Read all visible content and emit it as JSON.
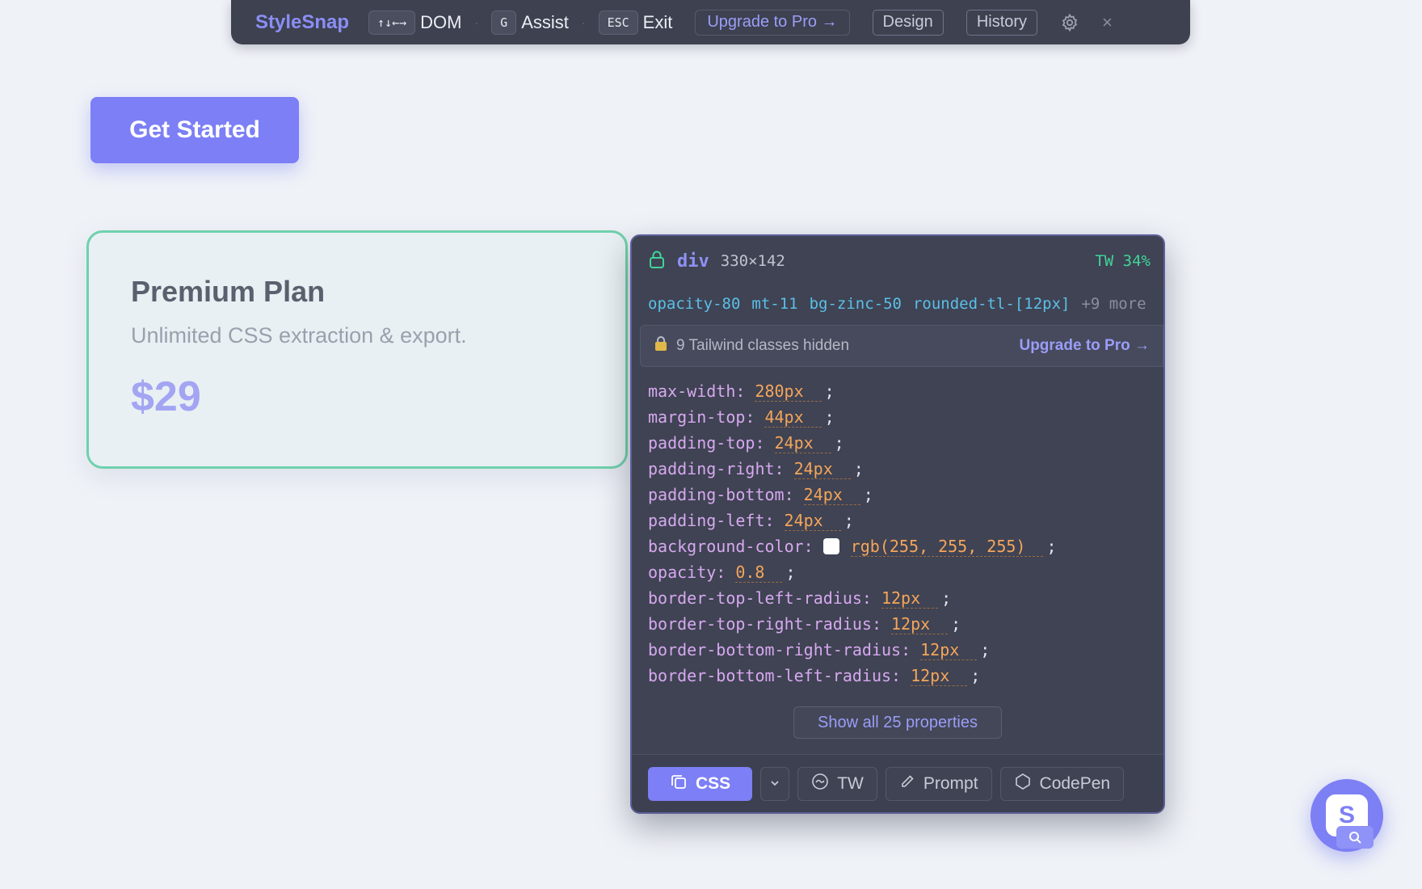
{
  "toolbar": {
    "brand": "StyleSnap",
    "shortcuts": [
      {
        "key": "↑↓←→",
        "label": "DOM"
      },
      {
        "key": "G",
        "label": "Assist"
      },
      {
        "key": "ESC",
        "label": "Exit"
      }
    ],
    "upgrade_label": "Upgrade to Pro →",
    "design_label": "Design",
    "history_label": "History",
    "close_glyph": "×"
  },
  "page": {
    "cta_label": "Get Started",
    "plan": {
      "title": "Premium Plan",
      "subtitle": "Unlimited CSS extraction & export.",
      "price": "$29"
    }
  },
  "inspector": {
    "tag": "div",
    "dimensions": "330×142",
    "tw_score": "TW 34%",
    "classes": [
      "opacity-80",
      "mt-11",
      "bg-zinc-50",
      "rounded-tl-[12px]"
    ],
    "more_classes": "+9 more",
    "hidden_notice": "9 Tailwind classes hidden",
    "hidden_upgrade": "Upgrade to Pro →",
    "properties": [
      {
        "name": "max-width:",
        "value": "280px"
      },
      {
        "name": "margin-top:",
        "value": "44px"
      },
      {
        "name": "padding-top:",
        "value": "24px"
      },
      {
        "name": "padding-right:",
        "value": "24px"
      },
      {
        "name": "padding-bottom:",
        "value": "24px"
      },
      {
        "name": "padding-left:",
        "value": "24px"
      },
      {
        "name": "background-color:",
        "value": "rgb(255, 255, 255)",
        "swatch": "#ffffff"
      },
      {
        "name": "opacity:",
        "value": "0.8"
      },
      {
        "name": "border-top-left-radius:",
        "value": "12px"
      },
      {
        "name": "border-top-right-radius:",
        "value": "12px"
      },
      {
        "name": "border-bottom-right-radius:",
        "value": "12px"
      },
      {
        "name": "border-bottom-left-radius:",
        "value": "12px"
      }
    ],
    "show_all_label": "Show all 25 properties",
    "footer": {
      "css_label": "CSS",
      "tw_label": "TW",
      "prompt_label": "Prompt",
      "codepen_label": "CodePen"
    }
  },
  "launcher": {
    "letter": "S"
  },
  "colors": {
    "accent": "#7c7ff5",
    "panel_bg": "#3f4353",
    "card_border": "#6fd1ad",
    "prop_name": "#d7a8f0",
    "prop_value": "#f5a55a",
    "class_color": "#5bbfe8",
    "tw_score": "#41d39a"
  }
}
